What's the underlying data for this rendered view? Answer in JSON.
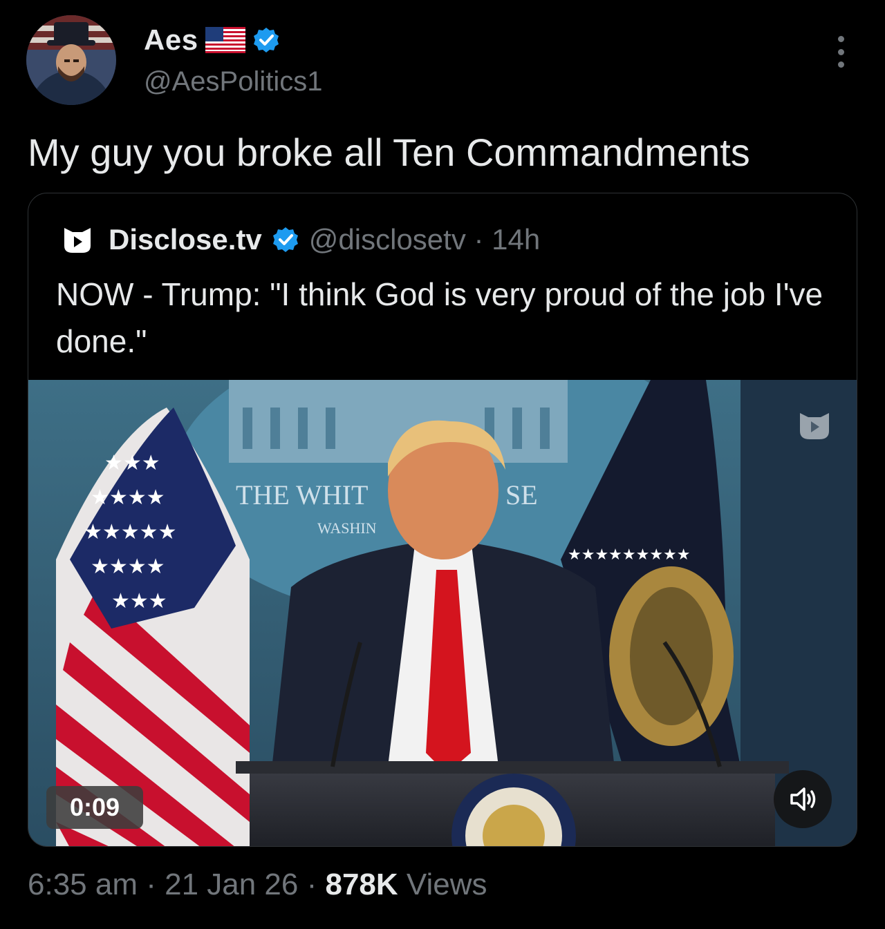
{
  "author": {
    "display_name": "Aes",
    "handle": "@AesPolitics1",
    "flag_icon": "us-flag-emoji",
    "verified_color": "#1d9bf0"
  },
  "tweet": {
    "text": "My guy you broke all Ten Commandments"
  },
  "quote": {
    "name": "Disclose.tv",
    "handle_time": "@disclosetv · 14h",
    "text": "NOW - Trump: \"I think God is very proud of the job I've done.\"",
    "video": {
      "duration": "0:09",
      "sound_icon": "speaker-muted-icon"
    }
  },
  "footer": {
    "time": "6:35 am",
    "sep1": " · ",
    "date": "21 Jan 26",
    "sep2": " · ",
    "views_count": "878K",
    "views_label": " Views"
  }
}
